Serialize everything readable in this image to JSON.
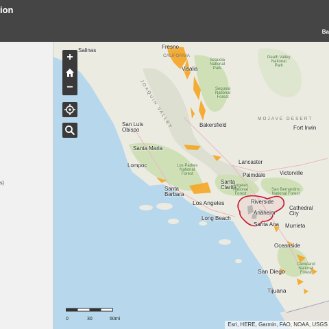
{
  "header": {
    "title": "ion",
    "right_text": "Ba"
  },
  "left_panel": {
    "fragment_text": "s)"
  },
  "map": {
    "labels": {
      "salinas": "Salinas",
      "fresno": "Fresno",
      "california": "CALIFORNIA",
      "visalia": "Visalia",
      "sequoia": "Sequoia\nNational\nPark",
      "sequoia_forest": "Sequoia\nNational\nForest",
      "death_valley": "Death Valley\nNational\nPark",
      "joaquin_valley": "JOAQUIN VALLEY",
      "mojave": "MOJAVE DESERT",
      "fort_irwin": "Fort Irwin",
      "san_luis_obispo": "San Luis\nObispo",
      "bakersfield": "Bakersfield",
      "santa_maria": "Santa Maria",
      "lompoc": "Lompoc",
      "los_padres": "Los Padres\nNational\nForest",
      "lancaster": "Lancaster",
      "palmdale": "Palmdale",
      "victorville": "Victorville",
      "santa_barbara": "Santa\nBarbara",
      "santa_clarita": "Santa\nClarita",
      "angeles_forest": "Angeles\nNational\nForest",
      "san_bernardino_forest": "San Bernardino\nNational Forest",
      "los_angeles": "Los Angeles",
      "riverside": "Riverside",
      "long_beach": "Long Beach",
      "anaheim": "Anaheim",
      "cathedral_city": "Cathedral\nCity",
      "santa_ana": "Santa Ana",
      "murrieta": "Murrieta",
      "oceanside": "Oceanside",
      "cleveland_forest": "Cleveland\nNational\nForest",
      "san_diego": "San Diego",
      "tijuana": "Tijuana"
    },
    "controls": {
      "zoom_in": "+",
      "zoom_out": "−"
    },
    "scalebar": {
      "labels": [
        "0",
        "30",
        "60mi"
      ]
    },
    "attribution": "Esri, HERE, Garmin, FAO, NOAA, USGS"
  },
  "colors": {
    "header_bg": "#454545",
    "water": "#b7d8ec",
    "land": "#ecebe2",
    "parks": "#cfe0b6",
    "fire_risk": "#f5a623",
    "boundary": "#c8102e"
  }
}
